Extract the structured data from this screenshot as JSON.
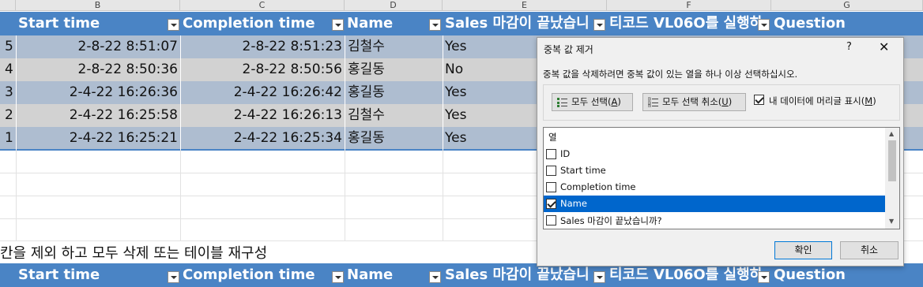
{
  "spreadsheet": {
    "column_letters": [
      "B",
      "C",
      "D",
      "E",
      "F",
      "G"
    ],
    "table_headers": [
      "Start time",
      "Completion time",
      "Name",
      "Sales 마감이 끝났습니",
      "티코드 VL06O를 실행하",
      "Question"
    ],
    "rows": [
      {
        "id": "5",
        "start": "2-8-22 8:51:07",
        "completion": "2-8-22 8:51:23",
        "name": "김철수",
        "sales": "Yes"
      },
      {
        "id": "4",
        "start": "2-8-22 8:50:36",
        "completion": "2-8-22 8:50:56",
        "name": "홍길동",
        "sales": "No"
      },
      {
        "id": "3",
        "start": "2-4-22 16:26:36",
        "completion": "2-4-22 16:26:42",
        "name": "홍길동",
        "sales": "Yes"
      },
      {
        "id": "2",
        "start": "2-4-22 16:25:58",
        "completion": "2-4-22 16:26:13",
        "name": "김철수",
        "sales": "Yes"
      },
      {
        "id": "1",
        "start": "2-4-22 16:25:21",
        "completion": "2-4-22 16:25:34",
        "name": "홍길동",
        "sales": "Yes"
      }
    ],
    "note_text": "칸을 제외 하고 모두 삭제 또는 테이블 재구성",
    "colors": {
      "header_bg": "#4a84c5",
      "row_odd": "#aebdd0",
      "row_even": "#d2d2d2"
    }
  },
  "dialog": {
    "title": "중복 값 제거",
    "help": "?",
    "close": "✕",
    "instruction": "중복 값을 삭제하려면 중복 값이 있는 열을 하나 이상 선택하십시오.",
    "select_all": {
      "text": "모두 선택(",
      "key": "A",
      "end": ")"
    },
    "unselect_all": {
      "text": "모두 선택 취소(",
      "key": "U",
      "end": ")"
    },
    "my_data_headers": {
      "text": "내 데이터에 머리글 표시(",
      "key": "M",
      "end": ")",
      "checked": true
    },
    "list_header": "열",
    "columns": [
      {
        "label": "ID",
        "checked": false
      },
      {
        "label": "Start time",
        "checked": false
      },
      {
        "label": "Completion time",
        "checked": false
      },
      {
        "label": "Name",
        "checked": true
      },
      {
        "label": "Sales 마감이 끝났습니까?",
        "checked": false
      }
    ],
    "ok": "확인",
    "cancel": "취소"
  }
}
